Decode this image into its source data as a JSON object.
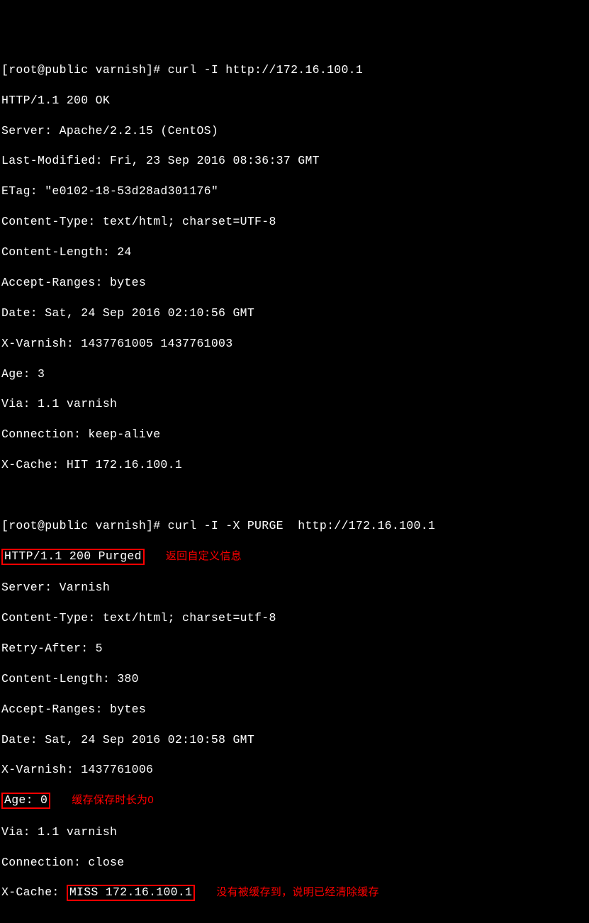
{
  "block1": {
    "prompt": "[root@public varnish]# curl -I http://172.16.100.1",
    "lines": [
      "HTTP/1.1 200 OK",
      "Server: Apache/2.2.15 (CentOS)",
      "Last-Modified: Fri, 23 Sep 2016 08:36:37 GMT",
      "ETag: \"e0102-18-53d28ad301176\"",
      "Content-Type: text/html; charset=UTF-8",
      "Content-Length: 24",
      "Accept-Ranges: bytes",
      "Date: Sat, 24 Sep 2016 02:10:56 GMT",
      "X-Varnish: 1437761005 1437761003",
      "Age: 3",
      "Via: 1.1 varnish",
      "Connection: keep-alive",
      "X-Cache: HIT 172.16.100.1"
    ]
  },
  "block2": {
    "prompt": "[root@public varnish]# curl -I -X PURGE  http://172.16.100.1",
    "purged": "HTTP/1.1 200 Purged",
    "annot_purged": "返回自定义信息",
    "lines_after_purged": [
      "Server: Varnish",
      "Content-Type: text/html; charset=utf-8",
      "Retry-After: 5",
      "Content-Length: 380",
      "Accept-Ranges: bytes",
      "Date: Sat, 24 Sep 2016 02:10:58 GMT",
      "X-Varnish: 1437761006"
    ],
    "age": "Age: 0",
    "annot_age": "缓存保存时长为0",
    "lines_after_age": [
      "Via: 1.1 varnish",
      "Connection: close"
    ],
    "xcache_label": "X-Cache: ",
    "xcache_val": "MISS 172.16.100.1",
    "annot_xcache": "没有被缓存到，说明已经清除缓存"
  }
}
